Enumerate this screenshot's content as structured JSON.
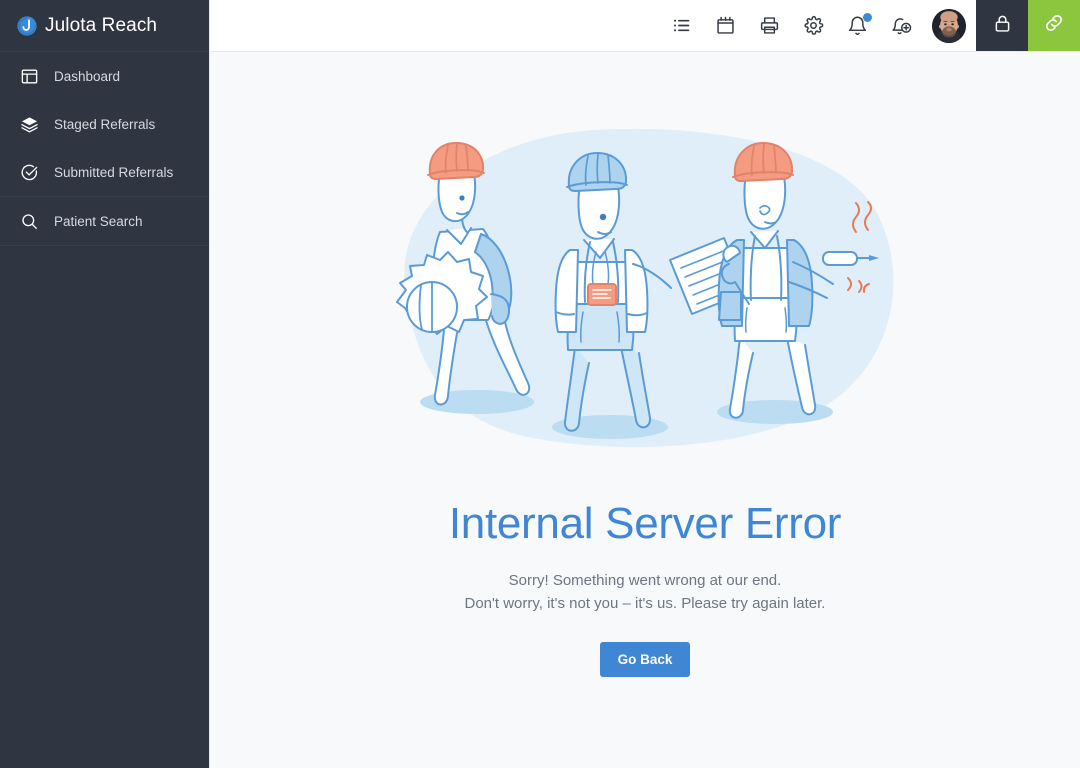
{
  "brand": {
    "title": "Julota Reach",
    "logo_icon": "julota-circle-j-logo",
    "logo_color": "#3b8ad9"
  },
  "sidebar": {
    "background_color": "#2f3541",
    "items": [
      {
        "label": "Dashboard",
        "icon": "dashboard-layout-icon"
      },
      {
        "label": "Staged Referrals",
        "icon": "layers-icon"
      },
      {
        "label": "Submitted Referrals",
        "icon": "check-circle-icon"
      },
      {
        "label": "Patient Search",
        "icon": "search-icon"
      }
    ]
  },
  "topbar": {
    "icons": [
      {
        "name": "list-icon",
        "label": "List"
      },
      {
        "name": "calendar-icon",
        "label": "Calendar"
      },
      {
        "name": "printer-icon",
        "label": "Print"
      },
      {
        "name": "gear-icon",
        "label": "Settings"
      },
      {
        "name": "bell-icon",
        "label": "Notifications",
        "badge": true
      },
      {
        "name": "bell-plus-icon",
        "label": "Add Notification"
      }
    ],
    "avatar": {
      "name": "user-avatar",
      "alt": "User profile photo"
    },
    "lock": {
      "name": "lock-icon",
      "label": "Lock",
      "background_color": "#2f3541"
    },
    "link": {
      "name": "link-icon",
      "label": "Link",
      "background_color": "#8cc63e"
    },
    "badge_color": "#3b8ad9"
  },
  "error_page": {
    "illustration": "three-workers-maintenance-illustration",
    "title": "Internal Server Error",
    "title_color": "#3f86d4",
    "line1": "Sorry! Something went wrong at our end.",
    "line2": "Don't worry, it's not you – it's us. Please try again later.",
    "button_label": "Go Back",
    "button_color": "#3f86d4",
    "palette": {
      "blob": "#dfeef8",
      "outline": "#5b9bd5",
      "hat_coral": "#f59b82",
      "jacket_blue": "#aed3ee",
      "shadow": "#b9d9ef"
    }
  }
}
